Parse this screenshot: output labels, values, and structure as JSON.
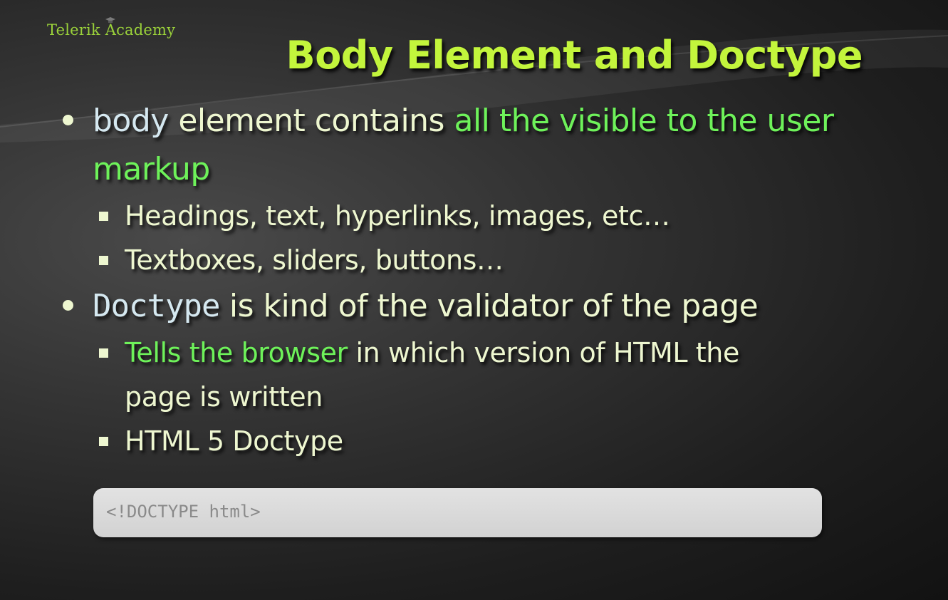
{
  "logo": {
    "text": "Telerik Academy"
  },
  "slide": {
    "title": "Body Element and Doctype"
  },
  "bullets": {
    "body": {
      "keyword": "body",
      "text": " element contains ",
      "highlight_line1": "all the visible to the user",
      "highlight_line2": "markup",
      "sub1": "Headings, text, hyperlinks, images, etc…",
      "sub2": "Textboxes, sliders, buttons…"
    },
    "doctype": {
      "keyword": "Doctype",
      "text": " is kind of the validator of the page",
      "sub1_highlight": "Tells the browser",
      "sub1_text_line1": " in which version of HTML the",
      "sub1_text_line2": "page is written",
      "sub2": "HTML 5 Doctype"
    }
  },
  "code": {
    "snippet": "<!DOCTYPE html>"
  },
  "colors": {
    "title": "#c3f53c",
    "text": "#eef7d0",
    "highlight": "#6ef25a",
    "keyword": "#d5e8f0",
    "logo": "#9ad13a",
    "code_bg": "#d8d8d8",
    "code_text": "#8a8a8a"
  }
}
